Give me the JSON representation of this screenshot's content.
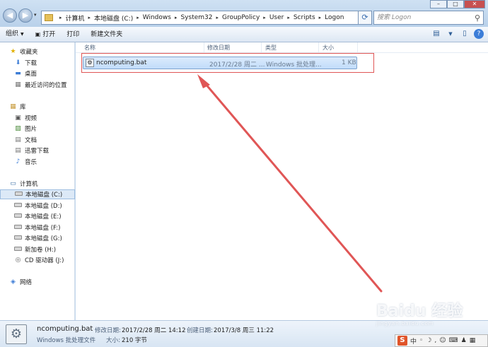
{
  "address": {
    "crumbs": [
      "计算机",
      "本地磁盘 (C:)",
      "Windows",
      "System32",
      "GroupPolicy",
      "User",
      "Scripts",
      "Logon"
    ]
  },
  "search": {
    "placeholder": "搜索 Logon"
  },
  "toolbar": {
    "organize": "组织",
    "open": "打开",
    "print": "打印",
    "new_folder": "新建文件夹"
  },
  "nav": {
    "favorites": "收藏夹",
    "fav_items": [
      "下载",
      "桌面",
      "最近访问的位置"
    ],
    "library": "库",
    "lib_items": [
      "视频",
      "图片",
      "文档",
      "迅雷下载",
      "音乐"
    ],
    "computer": "计算机",
    "drives": [
      "本地磁盘 (C:)",
      "本地磁盘 (D:)",
      "本地磁盘 (E:)",
      "本地磁盘 (F:)",
      "本地磁盘 (G:)",
      "新加卷 (H:)",
      "CD 驱动器 (J:)"
    ],
    "network": "网络"
  },
  "columns": {
    "name": "名称",
    "modified": "修改日期",
    "type": "类型",
    "size": "大小"
  },
  "file": {
    "name": "ncomputing.bat",
    "modified": "2017/2/28 周二 ...",
    "type": "Windows 批处理...",
    "size": "1 KB"
  },
  "details": {
    "name": "ncomputing.bat",
    "kind": "Windows 批处理文件",
    "modified_label": "修改日期:",
    "modified": "2017/2/28 周二 14:12",
    "created_label": "创建日期:",
    "created": "2017/3/8 周三 11:22",
    "size_label": "大小:",
    "size": "210 字节"
  },
  "watermark": {
    "brand": "Baidu 经验",
    "url": "jingyan.baidu.com"
  },
  "ime": {
    "logo": "S",
    "mode": "中"
  },
  "colors": {
    "highlight": "#e05656",
    "selection": "#c1dcfa",
    "chrome": "#c7dbef"
  }
}
